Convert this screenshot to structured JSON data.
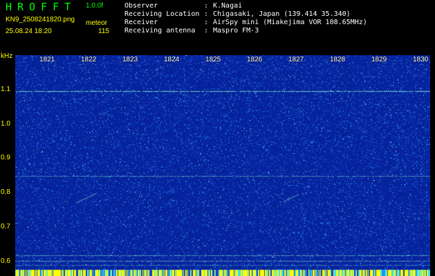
{
  "header": {
    "app_title": "HROFFT",
    "version": "1.0.0f",
    "filename": "KN9_2508241820.png",
    "mode": "meteor",
    "datetime": "25.08.24 18:20",
    "count": "115"
  },
  "metadata": [
    {
      "label": "Observer",
      "value": "K.Nagai"
    },
    {
      "label": "Receiving Location",
      "value": "Chigasaki, Japan (139.414 35.340)"
    },
    {
      "label": "Receiver",
      "value": "AirSpy mini (Miakejima VOR 108.65MHz)"
    },
    {
      "label": "Receiving antenna",
      "value": "Maspro FM-3"
    }
  ],
  "axis": {
    "y_unit": "kHz",
    "y_ticks": [
      "1.1",
      "1.0",
      "0.9",
      "0.8",
      "0.7",
      "0.6"
    ],
    "time_labels": [
      "1821",
      "1822",
      "1823",
      "1824",
      "1825",
      "1826",
      "1827",
      "1828",
      "1829",
      "1830"
    ]
  },
  "colors": {
    "background": "#000000",
    "title_green": "#00ff00",
    "label_yellow": "#ffff00",
    "spectrogram_base": "#06229a",
    "spectrogram_noise": "#34c4ff",
    "signal_line": "#99ffcc"
  }
}
